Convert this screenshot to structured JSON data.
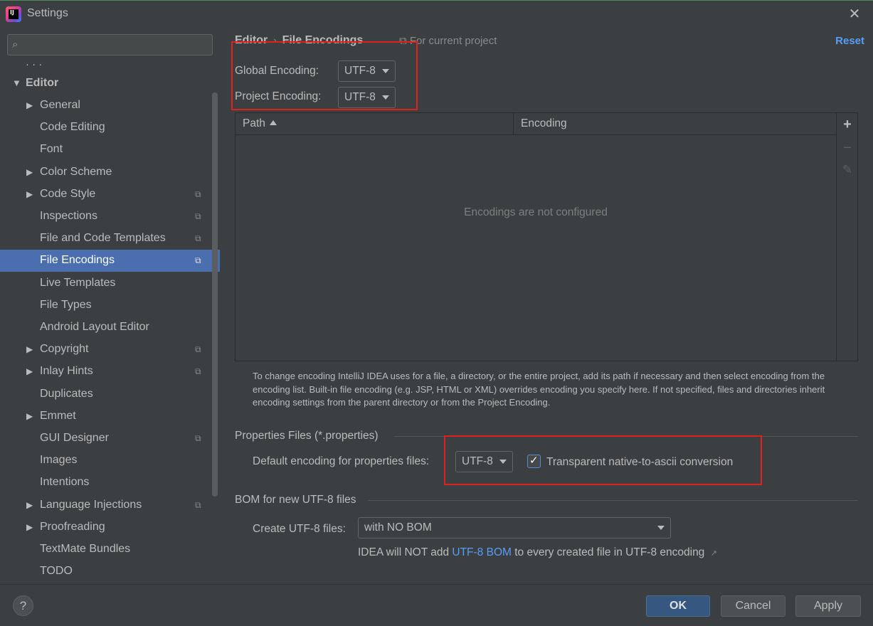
{
  "window": {
    "title": "Settings",
    "close_glyph": "✕"
  },
  "sidebar": {
    "search_placeholder": "",
    "root_label": "Editor",
    "items": [
      {
        "label": "General",
        "expandable": true,
        "project": false
      },
      {
        "label": "Code Editing",
        "expandable": false,
        "project": false
      },
      {
        "label": "Font",
        "expandable": false,
        "project": false
      },
      {
        "label": "Color Scheme",
        "expandable": true,
        "project": false
      },
      {
        "label": "Code Style",
        "expandable": true,
        "project": true
      },
      {
        "label": "Inspections",
        "expandable": false,
        "project": true
      },
      {
        "label": "File and Code Templates",
        "expandable": false,
        "project": true
      },
      {
        "label": "File Encodings",
        "expandable": false,
        "project": true,
        "selected": true
      },
      {
        "label": "Live Templates",
        "expandable": false,
        "project": false
      },
      {
        "label": "File Types",
        "expandable": false,
        "project": false
      },
      {
        "label": "Android Layout Editor",
        "expandable": false,
        "project": false
      },
      {
        "label": "Copyright",
        "expandable": true,
        "project": true
      },
      {
        "label": "Inlay Hints",
        "expandable": true,
        "project": true
      },
      {
        "label": "Duplicates",
        "expandable": false,
        "project": false
      },
      {
        "label": "Emmet",
        "expandable": true,
        "project": false
      },
      {
        "label": "GUI Designer",
        "expandable": false,
        "project": true
      },
      {
        "label": "Images",
        "expandable": false,
        "project": false
      },
      {
        "label": "Intentions",
        "expandable": false,
        "project": false
      },
      {
        "label": "Language Injections",
        "expandable": true,
        "project": true
      },
      {
        "label": "Proofreading",
        "expandable": true,
        "project": false
      },
      {
        "label": "TextMate Bundles",
        "expandable": false,
        "project": false
      },
      {
        "label": "TODO",
        "expandable": false,
        "project": false
      }
    ]
  },
  "header": {
    "breadcrumb_parent": "Editor",
    "breadcrumb_sep": "›",
    "breadcrumb_current": "File Encodings",
    "for_current_project": "For current project",
    "reset_label": "Reset"
  },
  "encodings": {
    "global_label": "Global Encoding:",
    "global_value": "UTF-8",
    "project_label": "Project Encoding:",
    "project_value": "UTF-8"
  },
  "table": {
    "columns": [
      "Path",
      "Encoding"
    ],
    "empty_text": "Encodings are not configured",
    "toolbar": {
      "add": "+",
      "remove": "−",
      "edit": "✎"
    }
  },
  "help_text": "To change encoding IntelliJ IDEA uses for a file, a directory, or the entire project, add its path if necessary and then select encoding from the encoding list. Built-in file encoding (e.g. JSP, HTML or XML) overrides encoding you specify here. If not specified, files and directories inherit encoding settings from the parent directory or from the Project Encoding.",
  "properties": {
    "section_title": "Properties Files (*.properties)",
    "default_label": "Default encoding for properties files:",
    "default_value": "UTF-8",
    "transparent_label": "Transparent native-to-ascii conversion",
    "transparent_checked": true
  },
  "bom": {
    "section_title": "BOM for new UTF-8 files",
    "create_label": "Create UTF-8 files:",
    "create_value": "with NO BOM",
    "info_prefix": "IDEA will NOT add",
    "info_link": "UTF-8 BOM",
    "info_suffix": "to every created file in UTF-8 encoding",
    "ext_glyph": "↗"
  },
  "footer": {
    "help_glyph": "?",
    "ok_label": "OK",
    "cancel_label": "Cancel",
    "apply_label": "Apply"
  },
  "colors": {
    "background": "#3c3f41",
    "selection": "#4b6eaf",
    "accent_link": "#589df6",
    "highlight_box": "#e01f1f",
    "primary_button": "#365880"
  }
}
